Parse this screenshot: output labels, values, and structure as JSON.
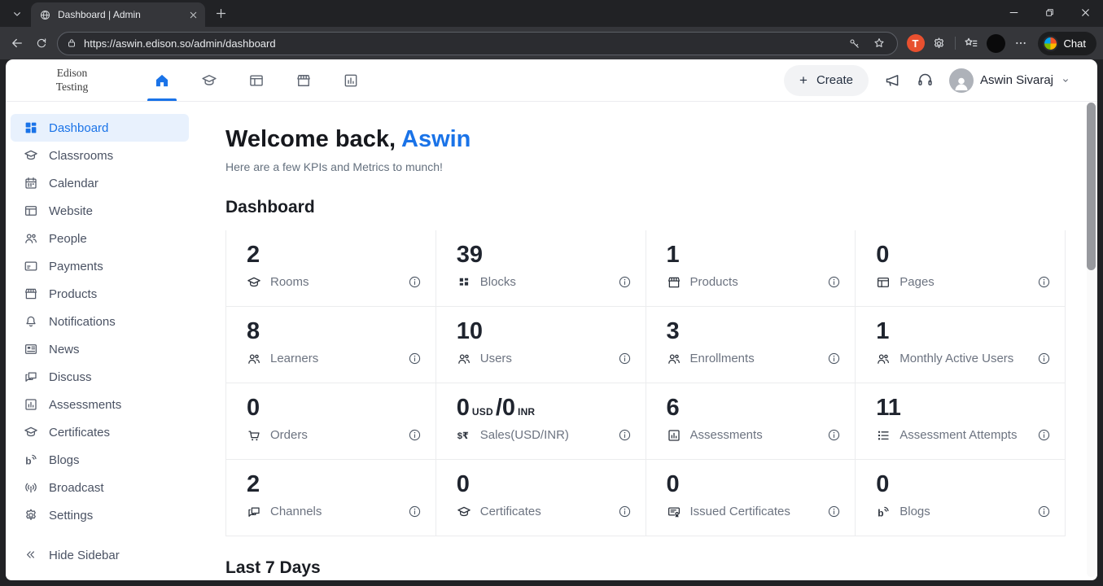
{
  "colors": {
    "accent": "#1a73e8",
    "active-bg": "#e8f1fd"
  },
  "browser": {
    "tab_title": "Dashboard | Admin",
    "url": "https://aswin.edison.so/admin/dashboard",
    "copilot_label": "Chat",
    "extension_badge": "T",
    "icons": {
      "tab_search": "chevron-down",
      "favicon": "globe",
      "tab_close": "close",
      "new_tab": "plus",
      "minimize": "minimize",
      "maximize": "restore",
      "window_close": "close",
      "back": "back",
      "refresh": "refresh",
      "lock": "lock",
      "key": "key",
      "favorite": "star",
      "extensions": "gear",
      "favorites_bar": "star-lines",
      "more": "dots"
    }
  },
  "header": {
    "logo_line1": "Edison",
    "logo_line2": "Testing",
    "nav": [
      {
        "name": "dashboard",
        "icon": "home",
        "active": true
      },
      {
        "name": "classrooms",
        "icon": "graduation-cap",
        "active": false
      },
      {
        "name": "website",
        "icon": "browser-window",
        "active": false
      },
      {
        "name": "store",
        "icon": "storefront",
        "active": false
      },
      {
        "name": "reports",
        "icon": "bar-chart",
        "active": false
      }
    ],
    "create_label": "Create",
    "create_plus": "+",
    "user_name": "Aswin Sivaraj",
    "icons": {
      "announce": "megaphone",
      "support": "headset",
      "avatar": "person",
      "user_caret": "chevron-down-small"
    }
  },
  "sidebar": {
    "items": [
      {
        "label": "Dashboard",
        "icon": "dashboard",
        "active": true
      },
      {
        "label": "Classrooms",
        "icon": "graduation-cap",
        "active": false
      },
      {
        "label": "Calendar",
        "icon": "calendar",
        "active": false
      },
      {
        "label": "Website",
        "icon": "browser-window",
        "active": false
      },
      {
        "label": "People",
        "icon": "people",
        "active": false
      },
      {
        "label": "Payments",
        "icon": "credit-card",
        "active": false
      },
      {
        "label": "Products",
        "icon": "storefront",
        "active": false
      },
      {
        "label": "Notifications",
        "icon": "bell",
        "active": false
      },
      {
        "label": "News",
        "icon": "newspaper",
        "active": false
      },
      {
        "label": "Discuss",
        "icon": "chat",
        "active": false
      },
      {
        "label": "Assessments",
        "icon": "bar-chart",
        "active": false
      },
      {
        "label": "Certificates",
        "icon": "graduation-cap",
        "active": false
      },
      {
        "label": "Blogs",
        "icon": "blog",
        "active": false
      },
      {
        "label": "Broadcast",
        "icon": "broadcast",
        "active": false
      },
      {
        "label": "Settings",
        "icon": "gear",
        "active": false
      }
    ],
    "hide_icon": "chevrons-left",
    "hide_label": "Hide Sidebar"
  },
  "main": {
    "welcome_prefix": "Welcome back,",
    "welcome_name": "Aswin",
    "subtitle": "Here are a few KPIs and Metrics to munch!",
    "section_title": "Dashboard",
    "info_icon": "info",
    "cards": [
      {
        "label": "Rooms",
        "icon": "graduation-cap",
        "value_parts": [
          {
            "text": "2"
          }
        ]
      },
      {
        "label": "Blocks",
        "icon": "blocks",
        "value_parts": [
          {
            "text": "39"
          }
        ]
      },
      {
        "label": "Products",
        "icon": "storefront",
        "value_parts": [
          {
            "text": "1"
          }
        ]
      },
      {
        "label": "Pages",
        "icon": "browser-window",
        "value_parts": [
          {
            "text": "0"
          }
        ]
      },
      {
        "label": "Learners",
        "icon": "people",
        "value_parts": [
          {
            "text": "8"
          }
        ]
      },
      {
        "label": "Users",
        "icon": "people",
        "value_parts": [
          {
            "text": "10"
          }
        ]
      },
      {
        "label": "Enrollments",
        "icon": "people",
        "value_parts": [
          {
            "text": "3"
          }
        ]
      },
      {
        "label": "Monthly Active Users",
        "icon": "people",
        "value_parts": [
          {
            "text": "1"
          }
        ]
      },
      {
        "label": "Orders",
        "icon": "cart",
        "value_parts": [
          {
            "text": "0"
          }
        ]
      },
      {
        "label": "Sales(USD/INR)",
        "icon": "currency",
        "value_parts": [
          {
            "text": "0"
          },
          {
            "text": "USD",
            "small": true
          },
          {
            "text": " / "
          },
          {
            "text": "0"
          },
          {
            "text": "INR",
            "small": true
          }
        ]
      },
      {
        "label": "Assessments",
        "icon": "bar-chart",
        "value_parts": [
          {
            "text": "6"
          }
        ]
      },
      {
        "label": "Assessment Attempts",
        "icon": "list",
        "value_parts": [
          {
            "text": "11"
          }
        ]
      },
      {
        "label": "Channels",
        "icon": "chat",
        "value_parts": [
          {
            "text": "2"
          }
        ]
      },
      {
        "label": "Certificates",
        "icon": "graduation-cap",
        "value_parts": [
          {
            "text": "0"
          }
        ]
      },
      {
        "label": "Issued Certificates",
        "icon": "certificate",
        "value_parts": [
          {
            "text": "0"
          }
        ]
      },
      {
        "label": "Blogs",
        "icon": "blog",
        "value_parts": [
          {
            "text": "0"
          }
        ]
      }
    ],
    "bottom_section_title": "Last 7 Days"
  }
}
